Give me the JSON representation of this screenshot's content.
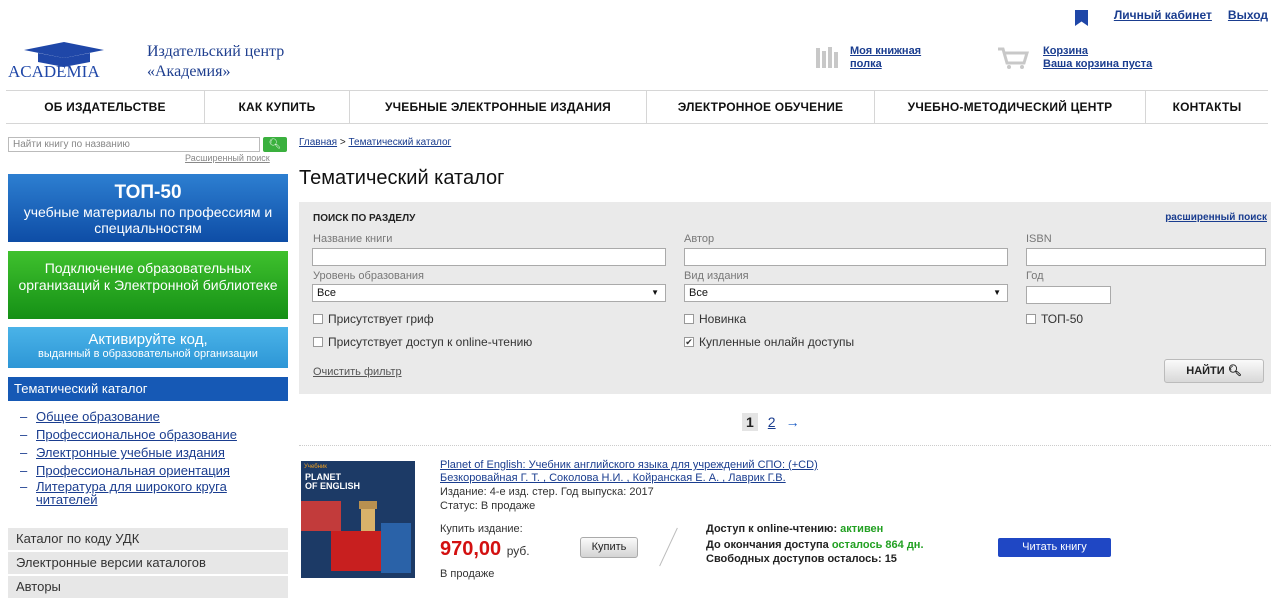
{
  "header": {
    "cabinet": "Личный кабинет",
    "logout": "Выход",
    "logo_text": "ACADEMIA",
    "publisher_line1": "Издательский центр",
    "publisher_line2": "«Академия»",
    "shelf_line1": "Моя книжная",
    "shelf_line2": "полка",
    "cart_title": "Корзина",
    "cart_status": "Ваша корзина пуста"
  },
  "nav": [
    "ОБ ИЗДАТЕЛЬСТВЕ",
    "КАК КУПИТЬ",
    "УЧЕБНЫЕ ЭЛЕКТРОННЫЕ ИЗДАНИЯ",
    "ЭЛЕКТРОННОЕ ОБУЧЕНИЕ",
    "УЧЕБНО-МЕТОДИЧЕСКИЙ ЦЕНТР",
    "КОНТАКТЫ"
  ],
  "sidebar": {
    "search_placeholder": "Найти книгу по названию",
    "advanced_search": "Расширенный поиск",
    "top50_title": "ТОП-50",
    "top50_sub": "учебные материалы по профессиям и специальностям",
    "connect_text": "Подключение образовательных организаций к Электронной библиотеке",
    "activate_title": "Активируйте код,",
    "activate_sub": "выданный в образовательной организации",
    "selected": "Тематический каталог",
    "subitems": [
      "Общее образование",
      "Профессиональное образование",
      "Электронные учебные издания",
      "Профессиональная ориентация",
      "Литература для широкого круга читателей"
    ],
    "items": [
      "Каталог по коду УДК",
      "Электронные версии каталогов",
      "Авторы"
    ]
  },
  "main": {
    "breadcrumb_home": "Главная",
    "breadcrumb_sep": " > ",
    "breadcrumb_current": "Тематический каталог",
    "title": "Тематический каталог"
  },
  "filter": {
    "title": "ПОИСК ПО РАЗДЕЛУ",
    "advanced": "расширенный поиск",
    "book_name": "Название книги",
    "author": "Автор",
    "isbn": "ISBN",
    "level": "Уровень образования",
    "level_value": "Все",
    "kind": "Вид издания",
    "kind_value": "Все",
    "year": "Год",
    "chk_grif": "Присутствует гриф",
    "chk_new": "Новинка",
    "chk_top50": "ТОП-50",
    "chk_online": "Присутствует доступ к online-чтению",
    "chk_bought": "Купленные онлайн доступы",
    "chk_bought_checked": true,
    "clear": "Очистить фильтр",
    "find": "НАЙТИ"
  },
  "pager": {
    "current": "1",
    "next": "2",
    "arrow": "→"
  },
  "book": {
    "cover_label": "Учебник",
    "cover_title1": "PLANET",
    "cover_title2": "OF ENGLISH",
    "title": "Planet of English: Учебник английского языка для учреждений СПО: (+CD)",
    "authors": "Безкоровайная Г. Т. , Соколова Н.И. , Койранская Е. А. , Лаврик Г.В.",
    "edition": "Издание: 4-е изд. стер. Год выпуска: 2017",
    "status": "Статус: В продаже",
    "buy_label": "Купить издание:",
    "price": "970,00",
    "currency": "руб.",
    "buy_button": "Купить",
    "in_stock": "В продаже",
    "access_label": "Доступ к online-чтению:",
    "access_value": "активен",
    "remaining_label": "До окончания доступа",
    "remaining_value": "осталось 864 дн.",
    "free_access": "Свободных доступов осталось: 15",
    "read_button": "Читать книгу"
  },
  "colors": {
    "accent": "#1659b5",
    "price": "#d31010",
    "green": "#22a022"
  }
}
